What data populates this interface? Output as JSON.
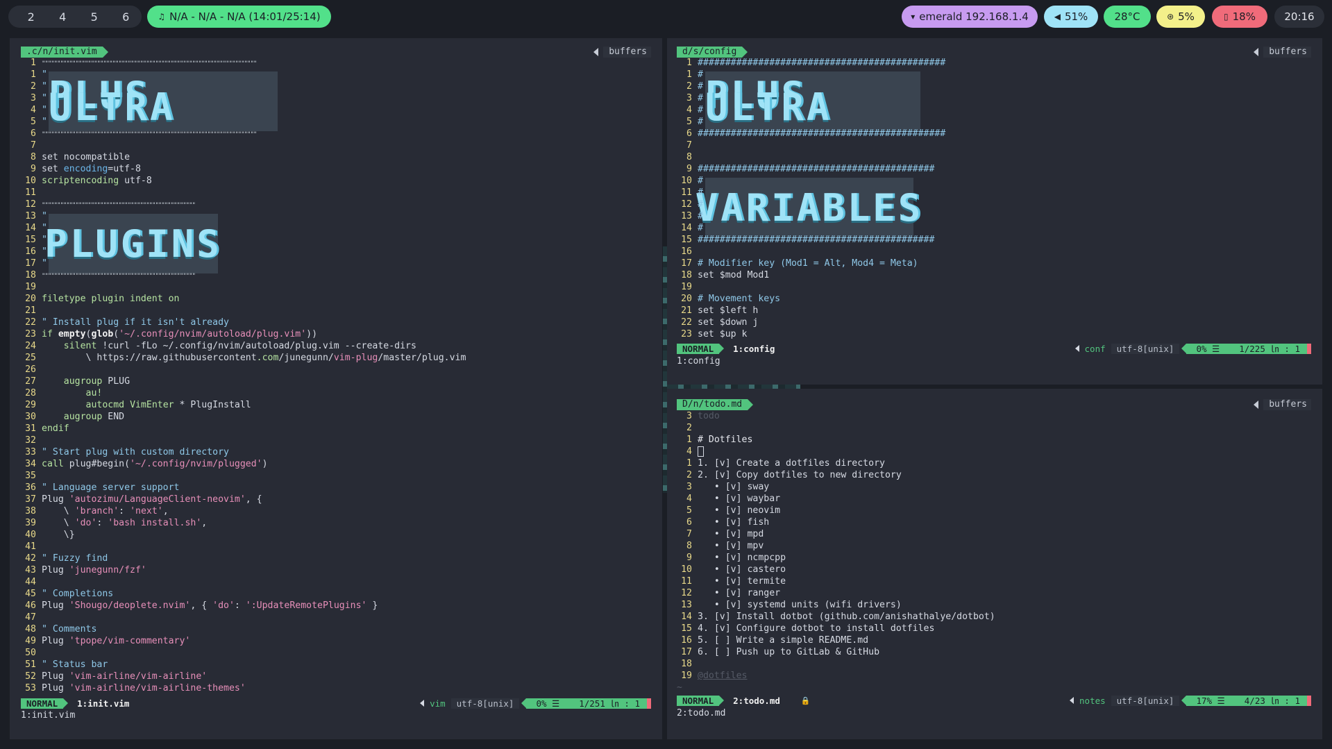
{
  "topbar": {
    "workspaces": [
      "2",
      "4",
      "5",
      "6"
    ],
    "media": "N/A - N/A - N/A (14:01/25:14)",
    "media_icon": "headphones-icon",
    "network": "emerald 192.168.1.4",
    "volume": "51%",
    "temperature": "28°C",
    "cpu": "5%",
    "battery": "18%",
    "clock": "20:16",
    "colors": {
      "media": "#52e08a",
      "network": "#c79bf0",
      "volume": "#9fe3f7",
      "temperature": "#52e08a",
      "cpu": "#f3f08a",
      "battery": "#f06b7a"
    }
  },
  "left_pane": {
    "buffer_name": ".c/n/init.vim",
    "buffers_label": "buffers",
    "banner_1": "PLUS ULTRA",
    "banner_2": "PLUGINS",
    "lines": [
      {
        "n": "1",
        "t": "\"\"\"\"\"\"\"\"\"\"\"\"\"\"\"\"\"\"\"\"\"\"\"\"\"\"\"\"\"\"\"\"\"\"\"\"\"\"\"\"\"\"\"\"\"\"\"\"\"\"\"\"\"\"\"\"\"\"\"\"\"\"\"\"\"\"\"\"\"\"",
        "c": "frame"
      },
      {
        "n": "1",
        "t": "\"",
        "c": "com"
      },
      {
        "n": "2",
        "t": "\"",
        "c": "com"
      },
      {
        "n": "3",
        "t": "\"",
        "c": "com"
      },
      {
        "n": "4",
        "t": "\"",
        "c": "com"
      },
      {
        "n": "5",
        "t": "\"",
        "c": "com"
      },
      {
        "n": "6",
        "t": "\"\"\"\"\"\"\"\"\"\"\"\"\"\"\"\"\"\"\"\"\"\"\"\"\"\"\"\"\"\"\"\"\"\"\"\"\"\"\"\"\"\"\"\"\"\"\"\"\"\"\"\"\"\"\"\"\"\"\"\"\"\"\"\"\"\"\"\"\"\"",
        "c": "frame"
      },
      {
        "n": "7",
        "t": "",
        "c": ""
      },
      {
        "n": "8",
        "t": "set nocompatible",
        "c": ""
      },
      {
        "n": "9",
        "t": "set encoding=utf-8",
        "c": "enc"
      },
      {
        "n": "10",
        "t": "scriptencoding utf-8",
        "c": "senc"
      },
      {
        "n": "11",
        "t": "",
        "c": ""
      },
      {
        "n": "12",
        "t": "\"\"\"\"\"\"\"\"\"\"\"\"\"\"\"\"\"\"\"\"\"\"\"\"\"\"\"\"\"\"\"\"\"\"\"\"\"\"\"\"\"\"\"\"\"\"\"\"\"\"",
        "c": "frame"
      },
      {
        "n": "13",
        "t": "\"",
        "c": "com"
      },
      {
        "n": "14",
        "t": "\"",
        "c": "com"
      },
      {
        "n": "15",
        "t": "\"",
        "c": "com"
      },
      {
        "n": "16",
        "t": "\"",
        "c": "com"
      },
      {
        "n": "17",
        "t": "\"",
        "c": "com"
      },
      {
        "n": "18",
        "t": "\"\"\"\"\"\"\"\"\"\"\"\"\"\"\"\"\"\"\"\"\"\"\"\"\"\"\"\"\"\"\"\"\"\"\"\"\"\"\"\"\"\"\"\"\"\"\"\"\"\"",
        "c": "frame"
      },
      {
        "n": "19",
        "t": "",
        "c": ""
      },
      {
        "n": "20",
        "t": "filetype plugin indent on",
        "c": "ft"
      },
      {
        "n": "21",
        "t": "",
        "c": ""
      },
      {
        "n": "22",
        "t": "\" Install plug if it isn't already",
        "c": "com"
      },
      {
        "n": "23",
        "t": "if empty(glob('~/.config/nvim/autoload/plug.vim'))",
        "c": "if"
      },
      {
        "n": "24",
        "t": "    silent !curl -fLo ~/.config/nvim/autoload/plug.vim --create-dirs",
        "c": "silent"
      },
      {
        "n": "25",
        "t": "        \\ https://raw.githubusercontent.com/junegunn/vim-plug/master/plug.vim",
        "c": "url"
      },
      {
        "n": "26",
        "t": "",
        "c": ""
      },
      {
        "n": "27",
        "t": "    augroup PLUG",
        "c": "aug"
      },
      {
        "n": "28",
        "t": "        au!",
        "c": "au"
      },
      {
        "n": "29",
        "t": "        autocmd VimEnter * PlugInstall",
        "c": "autocmd"
      },
      {
        "n": "30",
        "t": "    augroup END",
        "c": "aug"
      },
      {
        "n": "31",
        "t": "endif",
        "c": "kw"
      },
      {
        "n": "32",
        "t": "",
        "c": ""
      },
      {
        "n": "33",
        "t": "\" Start plug with custom directory",
        "c": "com"
      },
      {
        "n": "34",
        "t": "call plug#begin('~/.config/nvim/plugged')",
        "c": "call"
      },
      {
        "n": "35",
        "t": "",
        "c": ""
      },
      {
        "n": "36",
        "t": "\" Language server support",
        "c": "com"
      },
      {
        "n": "37",
        "t": "Plug 'autozimu/LanguageClient-neovim', {",
        "c": "plug"
      },
      {
        "n": "38",
        "t": "    \\ 'branch': 'next',",
        "c": "strs"
      },
      {
        "n": "39",
        "t": "    \\ 'do': 'bash install.sh',",
        "c": "strs"
      },
      {
        "n": "40",
        "t": "    \\}",
        "c": ""
      },
      {
        "n": "41",
        "t": "",
        "c": ""
      },
      {
        "n": "42",
        "t": "\" Fuzzy find",
        "c": "com"
      },
      {
        "n": "43",
        "t": "Plug 'junegunn/fzf'",
        "c": "plug"
      },
      {
        "n": "44",
        "t": "",
        "c": ""
      },
      {
        "n": "45",
        "t": "\" Completions",
        "c": "com"
      },
      {
        "n": "46",
        "t": "Plug 'Shougo/deoplete.nvim', { 'do': ':UpdateRemotePlugins' }",
        "c": "plug"
      },
      {
        "n": "47",
        "t": "",
        "c": ""
      },
      {
        "n": "48",
        "t": "\" Comments",
        "c": "com"
      },
      {
        "n": "49",
        "t": "Plug 'tpope/vim-commentary'",
        "c": "plug"
      },
      {
        "n": "50",
        "t": "",
        "c": ""
      },
      {
        "n": "51",
        "t": "\" Status bar",
        "c": "com"
      },
      {
        "n": "52",
        "t": "Plug 'vim-airline/vim-airline'",
        "c": "plug"
      },
      {
        "n": "53",
        "t": "Plug 'vim-airline/vim-airline-themes'",
        "c": "plug"
      }
    ],
    "status": {
      "mode": "NORMAL",
      "file": "1:init.vim",
      "filetype": "vim",
      "encoding": "utf-8[unix]",
      "percent": "0% ☰",
      "position": "1/251 ㏑ :  1"
    },
    "cmdline": "1:init.vim"
  },
  "top_right_pane": {
    "buffer_name": "d/s/config",
    "buffers_label": "buffers",
    "banner_1": "PLUS ULTRA",
    "banner_2": "VARIABLES",
    "lines": [
      {
        "n": "1",
        "t": "#############################################",
        "c": "hashframe"
      },
      {
        "n": "1",
        "t": "#",
        "c": "com"
      },
      {
        "n": "2",
        "t": "#",
        "c": "com"
      },
      {
        "n": "3",
        "t": "#",
        "c": "com"
      },
      {
        "n": "4",
        "t": "#",
        "c": "com"
      },
      {
        "n": "5",
        "t": "#",
        "c": "com"
      },
      {
        "n": "6",
        "t": "#############################################",
        "c": "hashframe"
      },
      {
        "n": "7",
        "t": "",
        "c": ""
      },
      {
        "n": "8",
        "t": "",
        "c": ""
      },
      {
        "n": "9",
        "t": "###########################################",
        "c": "hashframe"
      },
      {
        "n": "10",
        "t": "#",
        "c": "com"
      },
      {
        "n": "11",
        "t": "#",
        "c": "com"
      },
      {
        "n": "12",
        "t": "#",
        "c": "com"
      },
      {
        "n": "13",
        "t": "#",
        "c": "com"
      },
      {
        "n": "14",
        "t": "#",
        "c": "com"
      },
      {
        "n": "15",
        "t": "###########################################",
        "c": "hashframe"
      },
      {
        "n": "16",
        "t": "",
        "c": ""
      },
      {
        "n": "17",
        "t": "# Modifier key (Mod1 = Alt, Mod4 = Meta)",
        "c": "com"
      },
      {
        "n": "18",
        "t": "set $mod Mod1",
        "c": ""
      },
      {
        "n": "19",
        "t": "",
        "c": ""
      },
      {
        "n": "20",
        "t": "# Movement keys",
        "c": "com"
      },
      {
        "n": "21",
        "t": "set $left h",
        "c": ""
      },
      {
        "n": "22",
        "t": "set $down j",
        "c": ""
      },
      {
        "n": "23",
        "t": "set $up k",
        "c": ""
      }
    ],
    "status": {
      "mode": "NORMAL",
      "file": "1:config",
      "filetype": "conf",
      "encoding": "utf-8[unix]",
      "percent": "0% ☰",
      "position": "1/225 ㏑ :  1"
    },
    "cmdline": "1:config"
  },
  "bottom_right_pane": {
    "buffer_name": "D/n/todo.md",
    "buffers_label": "buffers",
    "lines": [
      {
        "n": "3",
        "t": "todo",
        "c": "dim"
      },
      {
        "n": "2",
        "t": "",
        "c": ""
      },
      {
        "n": "1",
        "t": "# Dotfiles",
        "c": "head"
      },
      {
        "n": "4",
        "t": "",
        "c": "cursor"
      },
      {
        "n": "1",
        "t": "1. [v] Create a dotfiles directory",
        "c": ""
      },
      {
        "n": "2",
        "t": "2. [v] Copy dotfiles to new directory",
        "c": ""
      },
      {
        "n": "3",
        "t": "   • [v] sway",
        "c": ""
      },
      {
        "n": "4",
        "t": "   • [v] waybar",
        "c": ""
      },
      {
        "n": "5",
        "t": "   • [v] neovim",
        "c": ""
      },
      {
        "n": "6",
        "t": "   • [v] fish",
        "c": ""
      },
      {
        "n": "7",
        "t": "   • [v] mpd",
        "c": ""
      },
      {
        "n": "8",
        "t": "   • [v] mpv",
        "c": ""
      },
      {
        "n": "9",
        "t": "   • [v] ncmpcpp",
        "c": ""
      },
      {
        "n": "10",
        "t": "   • [v] castero",
        "c": ""
      },
      {
        "n": "11",
        "t": "   • [v] termite",
        "c": ""
      },
      {
        "n": "12",
        "t": "   • [v] ranger",
        "c": ""
      },
      {
        "n": "13",
        "t": "   • [v] systemd units (wifi drivers)",
        "c": ""
      },
      {
        "n": "14",
        "t": "3. [v] Install dotbot (github.com/anishathalye/dotbot)",
        "c": ""
      },
      {
        "n": "15",
        "t": "4. [v] Configure dotbot to install dotfiles",
        "c": ""
      },
      {
        "n": "16",
        "t": "5. [ ] Write a simple README.md",
        "c": ""
      },
      {
        "n": "17",
        "t": "6. [ ] Push up to GitLab & GitHub",
        "c": ""
      },
      {
        "n": "18",
        "t": "",
        "c": ""
      },
      {
        "n": "19",
        "t": "@dotfiles",
        "c": "dimu"
      },
      {
        "n": "~",
        "t": "",
        "c": "tilde"
      }
    ],
    "status": {
      "mode": "NORMAL",
      "file": "2:todo.md",
      "filetype": "notes",
      "encoding": "utf-8[unix]",
      "percent": "17% ☰",
      "position": "4/23 ㏑ :  1"
    },
    "cmdline": "2:todo.md"
  }
}
